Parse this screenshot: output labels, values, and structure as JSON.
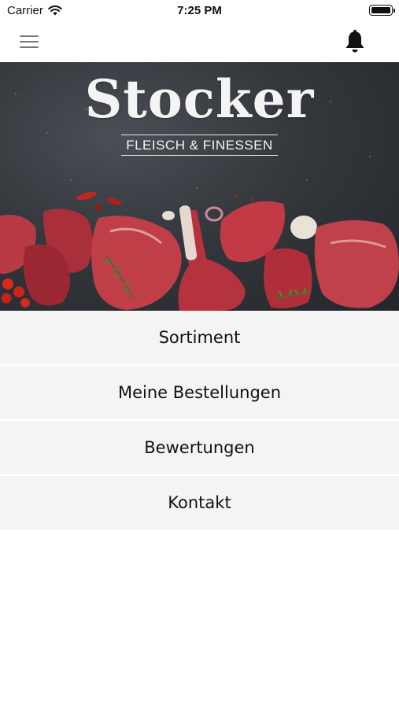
{
  "status_bar": {
    "carrier": "Carrier",
    "time": "7:25 PM"
  },
  "nav": {
    "menu_icon": "hamburger-icon",
    "notification_icon": "bell-icon"
  },
  "hero": {
    "title": "Stocker",
    "subtitle": "FLEISCH & FINESSEN"
  },
  "menu": {
    "items": [
      {
        "label": "Sortiment"
      },
      {
        "label": "Meine Bestellungen"
      },
      {
        "label": "Bewertungen"
      },
      {
        "label": "Kontakt"
      }
    ]
  },
  "colors": {
    "menu_background": "#f4f4f4",
    "hero_background": "#34383d",
    "meat_red": "#b8323e"
  }
}
